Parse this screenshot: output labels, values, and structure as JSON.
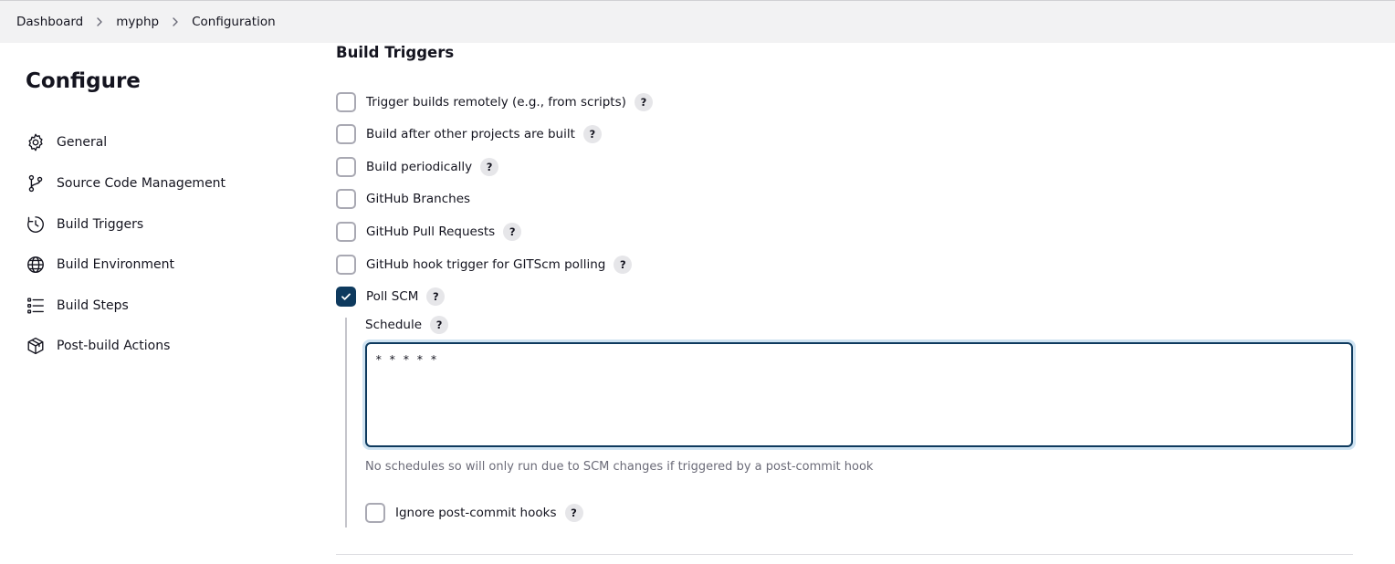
{
  "breadcrumb": {
    "items": [
      {
        "label": "Dashboard"
      },
      {
        "label": "myphp"
      },
      {
        "label": "Configuration"
      }
    ]
  },
  "page": {
    "title": "Configure"
  },
  "sidebar": {
    "items": [
      {
        "label": "General",
        "icon": "gear-icon"
      },
      {
        "label": "Source Code Management",
        "icon": "branch-icon"
      },
      {
        "label": "Build Triggers",
        "icon": "clock-icon"
      },
      {
        "label": "Build Environment",
        "icon": "globe-icon"
      },
      {
        "label": "Build Steps",
        "icon": "list-icon"
      },
      {
        "label": "Post-build Actions",
        "icon": "package-icon"
      }
    ]
  },
  "build_triggers": {
    "title": "Build Triggers",
    "options": [
      {
        "label": "Trigger builds remotely (e.g., from scripts)",
        "checked": false,
        "help": "?"
      },
      {
        "label": "Build after other projects are built",
        "checked": false,
        "help": "?"
      },
      {
        "label": "Build periodically",
        "checked": false,
        "help": "?"
      },
      {
        "label": "GitHub Branches",
        "checked": false,
        "help": ""
      },
      {
        "label": "GitHub Pull Requests",
        "checked": false,
        "help": "?"
      },
      {
        "label": "GitHub hook trigger for GITScm polling",
        "checked": false,
        "help": "?"
      },
      {
        "label": "Poll SCM",
        "checked": true,
        "help": "?"
      }
    ],
    "poll_scm": {
      "schedule_label": "Schedule",
      "schedule_help": "?",
      "schedule_value": "* * * * *",
      "schedule_message": "No schedules so will only run due to SCM changes if triggered by a post-commit hook",
      "ignore_hooks_label": "Ignore post-commit hooks",
      "ignore_hooks_checked": false,
      "ignore_hooks_help": "?"
    }
  },
  "colors": {
    "accent": "#0e3a5e",
    "focus_ring": "#cfe3f2",
    "topbar_bg": "#f2f2f3",
    "muted_text": "#6b6b78"
  }
}
